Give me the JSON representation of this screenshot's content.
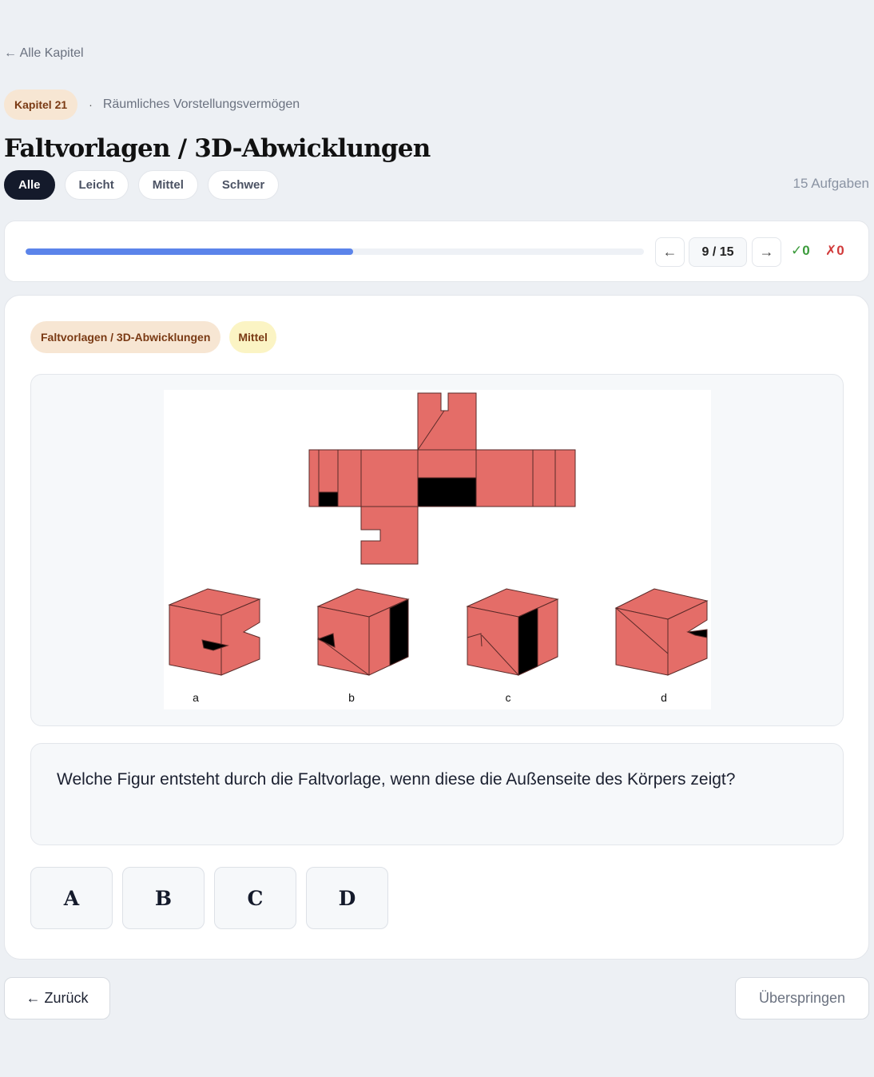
{
  "nav": {
    "back_link": "← Alle Kapitel"
  },
  "chapter": {
    "badge": "Kapitel 21",
    "separator": "·",
    "subject": "Räumliches Vorstellungsvermögen"
  },
  "page": {
    "title": "Faltvorlagen / 3D-Abwicklungen"
  },
  "filters": {
    "items": [
      {
        "label": "Alle",
        "active": true
      },
      {
        "label": "Leicht",
        "active": false
      },
      {
        "label": "Mittel",
        "active": false
      },
      {
        "label": "Schwer",
        "active": false
      }
    ],
    "task_count": "15 Aufgaben"
  },
  "progress": {
    "fraction": 0.53,
    "prev_icon": "arrow-left-icon",
    "prev_label": "←",
    "counter": "9 / 15",
    "next_icon": "arrow-right-icon",
    "next_label": "→",
    "correct": "✓0",
    "wrong": "✗0",
    "color_fill": "#5b84ea",
    "color_correct": "#3b9b3b",
    "color_wrong": "#d13a3a"
  },
  "question": {
    "topic_tag": "Faltvorlagen / 3D-Abwicklungen",
    "difficulty_tag": "Mittel",
    "figure": {
      "labels": [
        "a",
        "b",
        "c",
        "d"
      ],
      "face_color": "#e46d68"
    },
    "text": "Welche Figur entsteht durch die Faltvorlage, wenn diese die Außenseite des Körpers zeigt?",
    "answers": [
      "A",
      "B",
      "C",
      "D"
    ]
  },
  "footer": {
    "back_label": "← Zurück",
    "skip_label": "Überspringen"
  }
}
